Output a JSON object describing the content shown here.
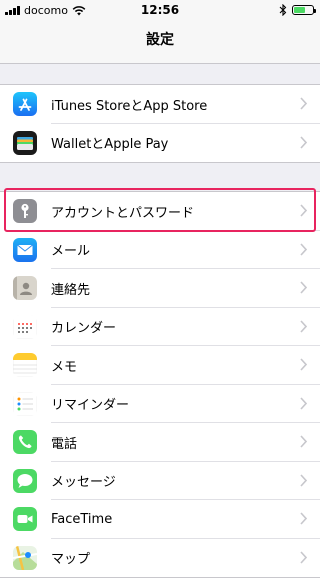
{
  "status": {
    "carrier": "docomo",
    "time": "12:56",
    "battery_level": 0.6
  },
  "nav": {
    "title": "設定"
  },
  "groups": [
    {
      "items": [
        {
          "label": "iTunes StoreとApp Store",
          "icon": "app-store-icon"
        },
        {
          "label": "WalletとApple Pay",
          "icon": "wallet-icon"
        }
      ]
    },
    {
      "items": [
        {
          "label": "アカウントとパスワード",
          "icon": "key-icon"
        },
        {
          "label": "メール",
          "icon": "mail-icon"
        },
        {
          "label": "連絡先",
          "icon": "contacts-icon"
        },
        {
          "label": "カレンダー",
          "icon": "calendar-icon"
        },
        {
          "label": "メモ",
          "icon": "notes-icon"
        },
        {
          "label": "リマインダー",
          "icon": "reminders-icon"
        },
        {
          "label": "電話",
          "icon": "phone-icon"
        },
        {
          "label": "メッセージ",
          "icon": "messages-icon"
        },
        {
          "label": "FaceTime",
          "icon": "facetime-icon"
        },
        {
          "label": "マップ",
          "icon": "maps-icon"
        }
      ]
    }
  ],
  "colors": {
    "highlight": "#e8245f",
    "background": "#efeff4"
  }
}
